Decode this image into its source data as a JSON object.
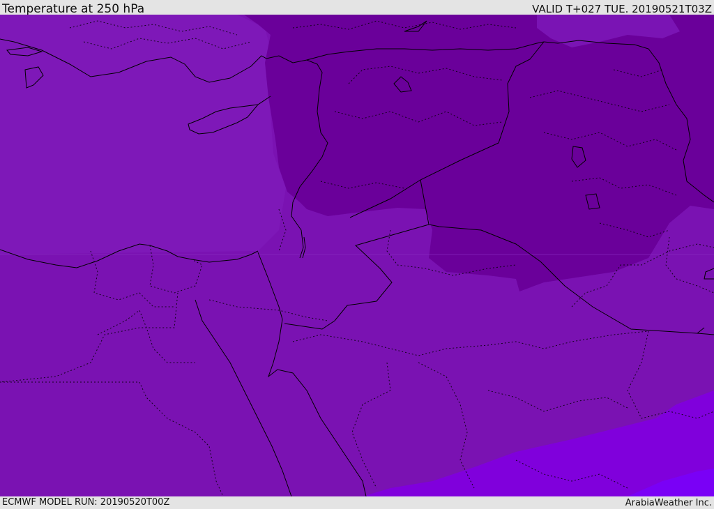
{
  "header": {
    "title": "Temperature at 250 hPa",
    "valid_time": "VALID T+027 TUE. 20190521T03Z"
  },
  "footer": {
    "model_run": "ECMWF MODEL RUN: 20190520T00Z",
    "credit": "ArabiaWeather Inc."
  },
  "colors": {
    "field_base": "#7a12b2",
    "field_cold": "#6a009a",
    "field_light_nw": "#7e18b8",
    "field_warm_1": "#8000dc",
    "field_warm_2": "#7a00f6",
    "border_line": "#000000",
    "bar_background": "#e4e4e4"
  }
}
